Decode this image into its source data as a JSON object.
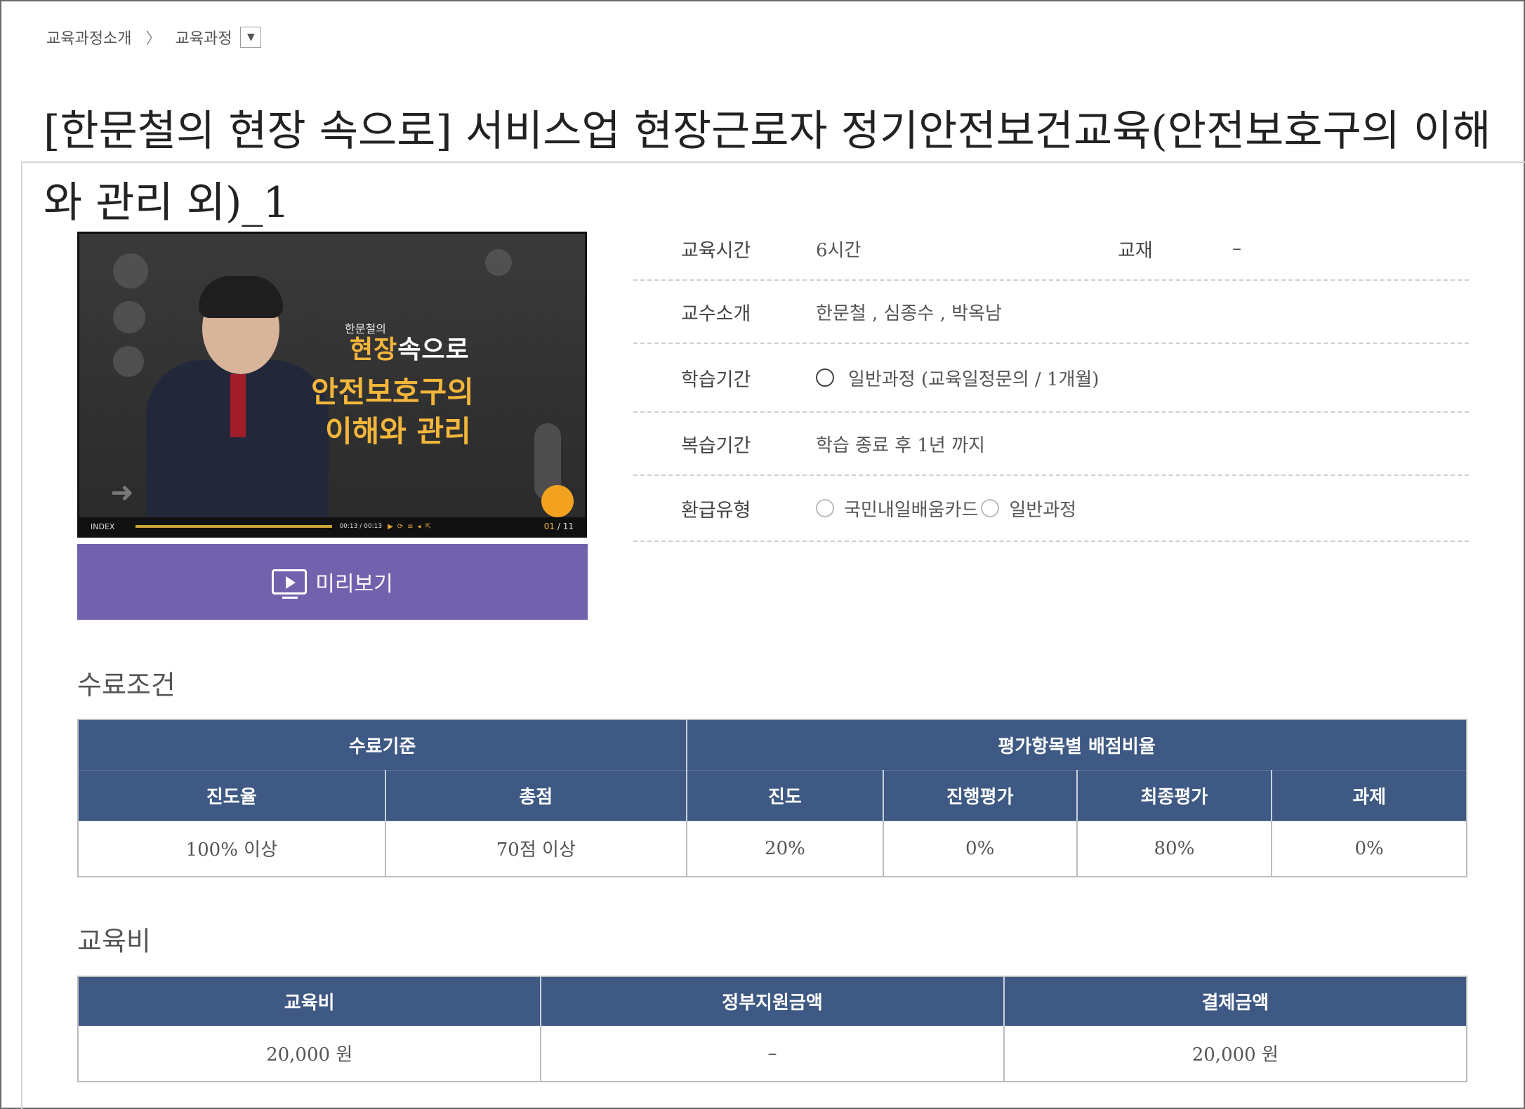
{
  "breadcrumb": {
    "parent": "교육과정소개",
    "separator": "〉",
    "current": "교육과정",
    "dropdown_icon": "chevron-down-icon"
  },
  "course": {
    "title": "[한문철의 현장 속으로] 서비스업 현장근로자 정기안전보건교육(안전보호구의 이해와 관리 외)_1"
  },
  "thumbnail": {
    "small_caption": "한문철의",
    "headline_highlight": "현장",
    "headline_rest": "속으로",
    "line2": "안전보호구의",
    "line3": "이해와 관리",
    "player": {
      "index_label": "INDEX",
      "time": "00:13 / 00:13",
      "page_current": "01",
      "page_total": "/ 11"
    }
  },
  "preview": {
    "label": "미리보기"
  },
  "info": {
    "hours_label": "교육시간",
    "hours_value": "6시간",
    "textbook_label": "교재",
    "textbook_value": "–",
    "instructors_label": "교수소개",
    "instructors_value": "한문철 , 심종수 , 박옥남",
    "period_label": "학습기간",
    "period_value": "일반과정 (교육일정문의 / 1개월)",
    "review_label": "복습기간",
    "review_value": "학습 종료 후 1년 까지",
    "refund_label": "환급유형",
    "refund_option1": "국민내일배움카드",
    "refund_option2": "일반과정"
  },
  "completion": {
    "section_title": "수료조건",
    "group1": "수료기준",
    "group2": "평가항목별 배점비율",
    "headers": [
      "진도율",
      "총점",
      "진도",
      "진행평가",
      "최종평가",
      "과제"
    ],
    "values": [
      "100% 이상",
      "70점 이상",
      "20%",
      "0%",
      "80%",
      "0%"
    ]
  },
  "fee": {
    "section_title": "교육비",
    "headers": [
      "교육비",
      "정부지원금액",
      "결제금액"
    ],
    "values": [
      "20,000 원",
      "–",
      "20,000 원"
    ]
  },
  "colors": {
    "table_header": "#3e5983",
    "preview_button": "#7262ae",
    "promo_yellow": "#f3b63b"
  }
}
